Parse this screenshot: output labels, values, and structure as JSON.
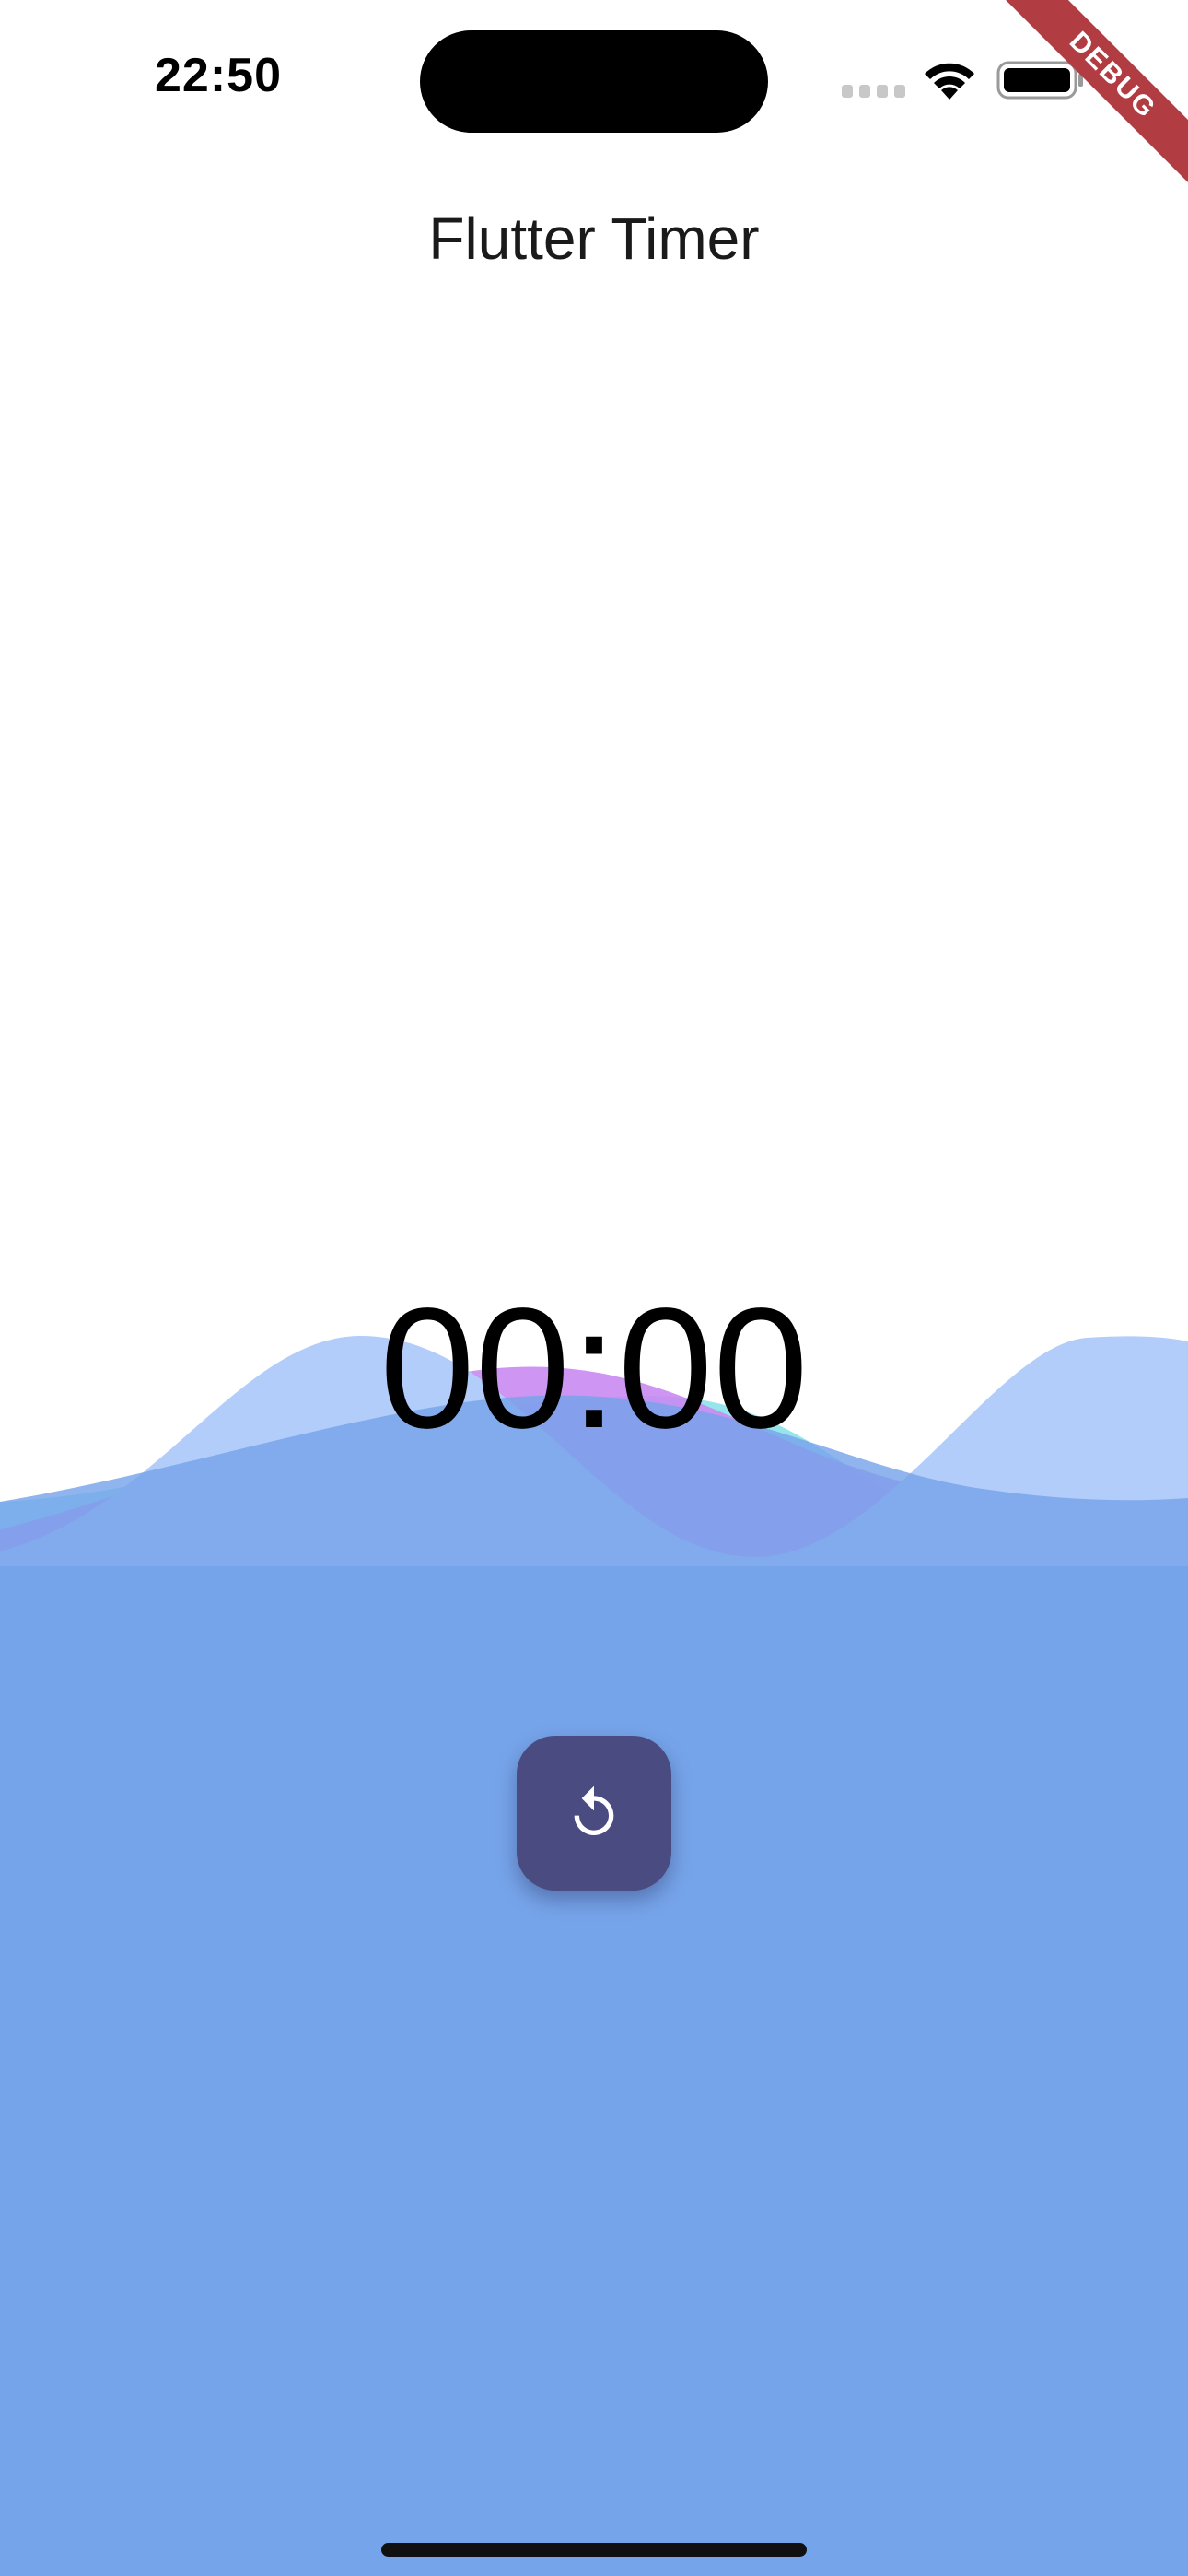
{
  "status_bar": {
    "time": "22:50"
  },
  "debug_banner": {
    "label": "DEBUG"
  },
  "app_bar": {
    "title": "Flutter Timer"
  },
  "timer": {
    "display": "00:00"
  },
  "actions": {
    "reset_icon": "replay-icon"
  },
  "colors": {
    "wave_base": "#76a4ea",
    "wave_light_blue": "#b3cdfa",
    "wave_purple": "#c98af2",
    "wave_cyan": "#96e4ec",
    "button": "#4a4b80",
    "debug_banner": "#b13c41"
  }
}
